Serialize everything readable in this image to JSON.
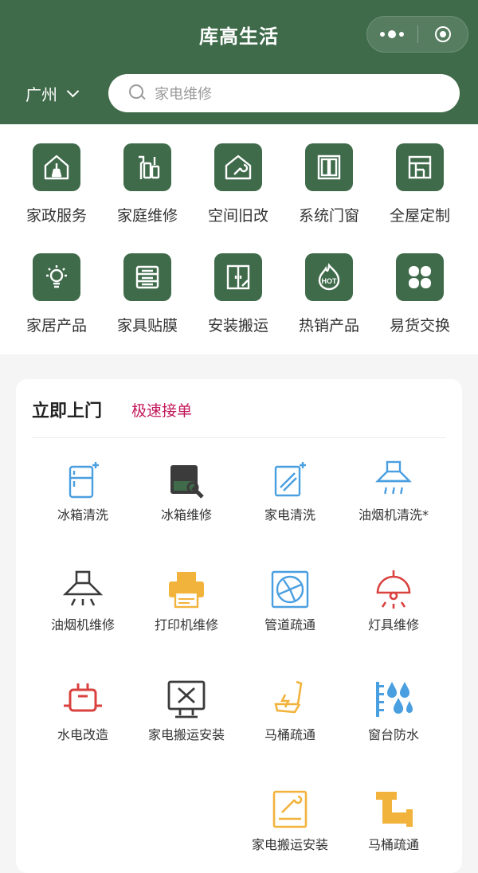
{
  "header": {
    "title": "库高生活",
    "city": "广州",
    "search_placeholder": "家电维修"
  },
  "categories": [
    {
      "label": "家政服务",
      "icon": "house-broom-icon"
    },
    {
      "label": "家庭维修",
      "icon": "tools-icon"
    },
    {
      "label": "空间旧改",
      "icon": "house-wrench-icon"
    },
    {
      "label": "系统门窗",
      "icon": "window-icon"
    },
    {
      "label": "全屋定制",
      "icon": "cabinet-layout-icon"
    },
    {
      "label": "家居产品",
      "icon": "lightbulb-icon"
    },
    {
      "label": "家具贴膜",
      "icon": "drawer-cabinet-icon"
    },
    {
      "label": "安装搬运",
      "icon": "wardrobe-tool-icon"
    },
    {
      "label": "热销产品",
      "icon": "hot-flame-icon"
    },
    {
      "label": "易货交换",
      "icon": "four-petal-icon"
    }
  ],
  "services_card": {
    "title": "立即上门",
    "subtitle": "极速接单",
    "items": [
      {
        "label": "冰箱清洗",
        "icon": "fridge-clean-icon"
      },
      {
        "label": "冰箱维修",
        "icon": "fridge-repair-icon"
      },
      {
        "label": "家电清洗",
        "icon": "appliance-clean-icon"
      },
      {
        "label": "油烟机清洗*",
        "icon": "range-hood-clean-icon"
      },
      {
        "label": "油烟机维修",
        "icon": "range-hood-repair-icon"
      },
      {
        "label": "打印机维修",
        "icon": "printer-icon"
      },
      {
        "label": "管道疏通",
        "icon": "fan-vent-icon"
      },
      {
        "label": "灯具维修",
        "icon": "ceiling-lamp-icon"
      },
      {
        "label": "水电改造",
        "icon": "plug-icon"
      },
      {
        "label": "家电搬运安装",
        "icon": "monitor-tools-icon"
      },
      {
        "label": "马桶疏通",
        "icon": "toilet-icon"
      },
      {
        "label": "窗台防水",
        "icon": "waterproof-icon"
      },
      {
        "label": "家电搬运安装",
        "icon": "oven-wrench-icon"
      },
      {
        "label": "马桶疏通",
        "icon": "pipe-icon"
      }
    ]
  },
  "colors": {
    "brand_green": "#3f6b4a",
    "accent_pink": "#c2185b",
    "icon_blue": "#4a9fe0",
    "icon_orange": "#f2b33d",
    "icon_red": "#d9423f",
    "icon_dark": "#3b3b3b"
  }
}
